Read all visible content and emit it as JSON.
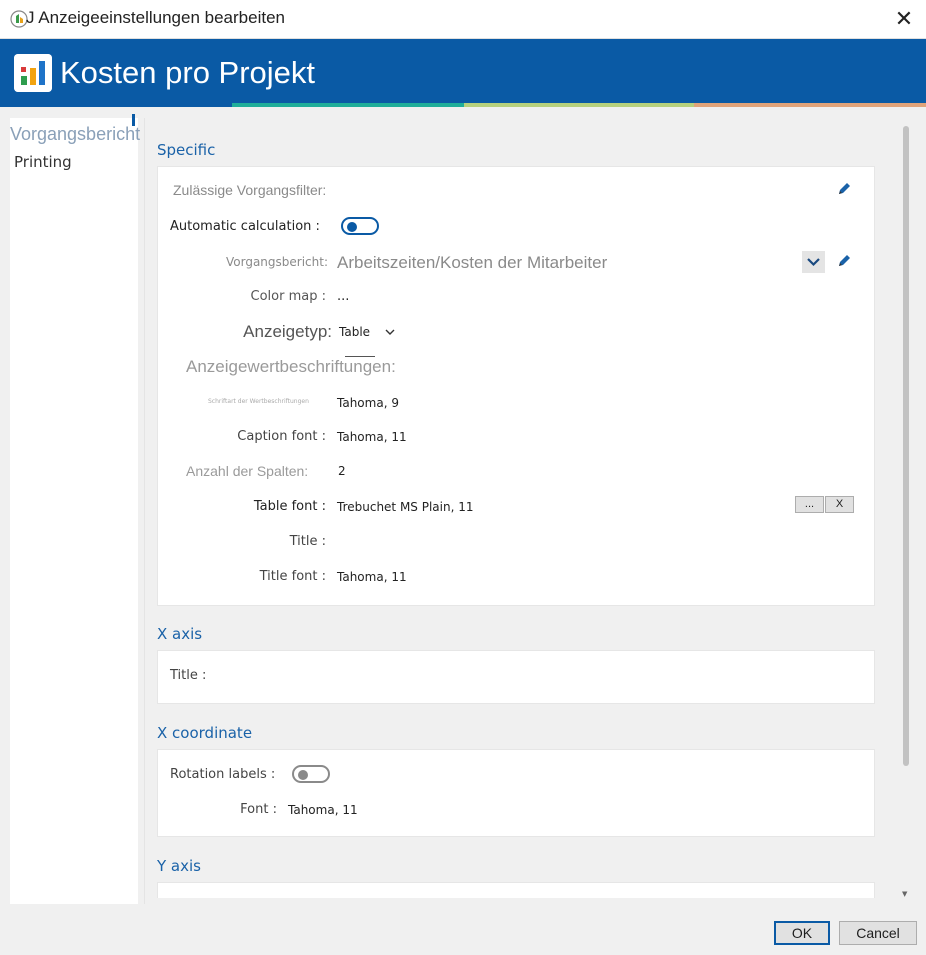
{
  "window": {
    "title": "J Anzeigeeinstellungen bearbeiten"
  },
  "header": {
    "title": "Kosten pro Projekt"
  },
  "colors": {
    "brand": "#0a5aa5",
    "accent_teal": "#1fae9a",
    "accent_green": "#b6d07d",
    "accent_orange": "#e0a37a"
  },
  "nav": {
    "items": [
      {
        "label": "Vorgangsbericht"
      },
      {
        "label": "Printing"
      }
    ]
  },
  "sections": {
    "specific": {
      "title": "Specific",
      "allowed_filters_label": "Zulässige Vorgangsfilter:",
      "auto_calc_label": "Automatic calculation :",
      "auto_calc_on": true,
      "report_label": "Vorgangsbericht:",
      "report_value": "Arbeitszeiten/Kosten der Mitarbeiter",
      "color_map_label": "Color map :",
      "color_map_value": "...",
      "display_type_label": "Anzeigetyp:",
      "display_type_value": "Table",
      "value_captions_label": "Anzeigewertbeschriftungen:",
      "caption_font_small_label": "Schriftart der Wertbeschriftungen",
      "caption_font_small_value": "Tahoma, 9",
      "caption_font_label": "Caption font :",
      "caption_font_value": "Tahoma, 11",
      "columns_label": "Anzahl der Spalten:",
      "columns_value": "2",
      "table_font_label": "Table font :",
      "table_font_value": "Trebuchet MS Plain, 11",
      "table_font_browse": "...",
      "table_font_clear": "X",
      "title_label": "Title :",
      "title_font_label": "Title font :",
      "title_font_value": "Tahoma, 11"
    },
    "x_axis": {
      "title": "X axis",
      "title_label": "Title :"
    },
    "x_coordinate": {
      "title": "X coordinate",
      "rotation_label": "Rotation labels :",
      "rotation_on": false,
      "font_label": "Font :",
      "font_value": "Tahoma, 11"
    },
    "y_axis": {
      "title": "Y axis"
    }
  },
  "buttons": {
    "ok": "OK",
    "cancel": "Cancel"
  },
  "icons": {
    "app": "app-icon",
    "close": "close-icon",
    "logo": "chart-logo-icon",
    "edit": "pencil-icon",
    "dropdown": "chevron-down-icon"
  }
}
